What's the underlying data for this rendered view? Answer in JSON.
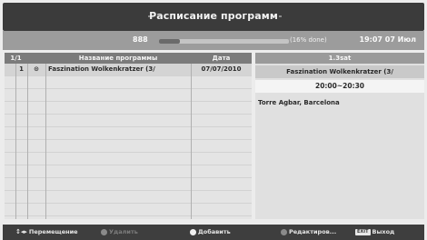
{
  "header": {
    "title": "Расписание программ"
  },
  "status": {
    "channel": "888",
    "progress_text": "(16% done)",
    "progress_fraction": 0.16,
    "clock": "19:07 07 Июл"
  },
  "table": {
    "columns": [
      "1/1",
      "",
      "Название программы",
      "Дата"
    ],
    "rows": [
      {
        "num": "1",
        "icon": "record-icon",
        "name": "Faszination Wolkenkratzer (3/",
        "date": "07/07/2010"
      }
    ]
  },
  "detail": {
    "tab": "1.3sat",
    "program_title": "Faszination Wolkenkratzer (3/",
    "time": "20:00~20:30",
    "description": "Torre Agbar, Barcelona"
  },
  "footer": {
    "move": "Перемещение",
    "delete": "Удалить",
    "add": "Добавить",
    "edit": "Редактиров...",
    "exit_key": "EXIT",
    "exit": "Выход"
  }
}
